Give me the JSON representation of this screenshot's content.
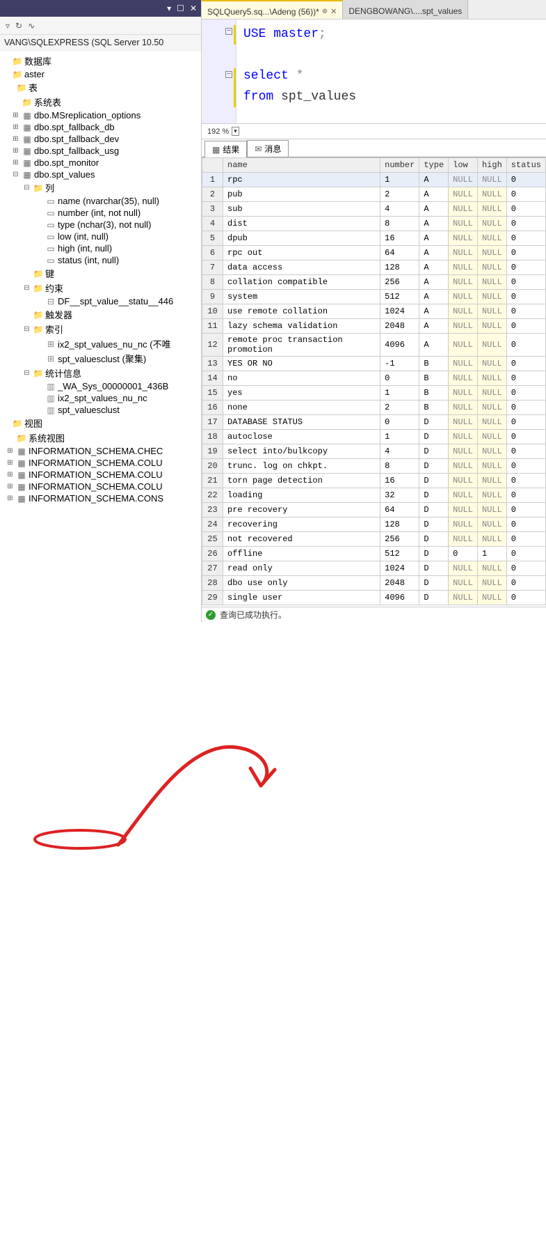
{
  "sidebar": {
    "server": "VANG\\SQLEXPRESS (SQL Server 10.50",
    "nodes": {
      "databases": "数据库",
      "master": "aster",
      "tables": "表",
      "systables": "系统表",
      "tableItems": [
        "dbo.MSreplication_options",
        "dbo.spt_fallback_db",
        "dbo.spt_fallback_dev",
        "dbo.spt_fallback_usg",
        "dbo.spt_monitor",
        "dbo.spt_values"
      ],
      "cols_label": "列",
      "cols": [
        "name (nvarchar(35), null)",
        "number (int, not null)",
        "type (nchar(3), not null)",
        "low (int, null)",
        "high (int, null)",
        "status (int, null)"
      ],
      "keys_label": "键",
      "constraints_label": "约束",
      "constraints": [
        "DF__spt_value__statu__446"
      ],
      "triggers_label": "触发器",
      "indexes_label": "索引",
      "indexes": [
        "ix2_spt_values_nu_nc (不唯",
        "spt_valuesclust (聚集)"
      ],
      "stats_label": "统计信息",
      "stats": [
        "_WA_Sys_00000001_436B",
        "ix2_spt_values_nu_nc",
        "spt_valuesclust"
      ],
      "views_label": "视图",
      "sysviews_label": "系统视图",
      "views": [
        "INFORMATION_SCHEMA.CHEC",
        "INFORMATION_SCHEMA.COLU",
        "INFORMATION_SCHEMA.COLU",
        "INFORMATION_SCHEMA.COLU",
        "INFORMATION_SCHEMA.CONS"
      ]
    }
  },
  "tabs": [
    {
      "label": "SQLQuery5.sq...\\Adeng (56))*",
      "active": true
    },
    {
      "label": "DENGBOWANG\\....spt_values",
      "active": false
    }
  ],
  "code": {
    "l1": "USE",
    "l1b": "master",
    "l2": "select",
    "l2b": "*",
    "l3": "from",
    "l3b": "spt_values"
  },
  "zoom": "192 %",
  "resultTabs": {
    "results": "结果",
    "messages": "消息"
  },
  "columns": [
    "",
    "name",
    "number",
    "type",
    "low",
    "high",
    "status"
  ],
  "rows": [
    {
      "n": 1,
      "name": "rpc",
      "number": "1",
      "type": "A",
      "low": "NULL",
      "high": "NULL",
      "status": "0"
    },
    {
      "n": 2,
      "name": "pub",
      "number": "2",
      "type": "A",
      "low": "NULL",
      "high": "NULL",
      "status": "0"
    },
    {
      "n": 3,
      "name": "sub",
      "number": "4",
      "type": "A",
      "low": "NULL",
      "high": "NULL",
      "status": "0"
    },
    {
      "n": 4,
      "name": "dist",
      "number": "8",
      "type": "A",
      "low": "NULL",
      "high": "NULL",
      "status": "0"
    },
    {
      "n": 5,
      "name": "dpub",
      "number": "16",
      "type": "A",
      "low": "NULL",
      "high": "NULL",
      "status": "0"
    },
    {
      "n": 6,
      "name": "rpc out",
      "number": "64",
      "type": "A",
      "low": "NULL",
      "high": "NULL",
      "status": "0"
    },
    {
      "n": 7,
      "name": "data access",
      "number": "128",
      "type": "A",
      "low": "NULL",
      "high": "NULL",
      "status": "0"
    },
    {
      "n": 8,
      "name": "collation compatible",
      "number": "256",
      "type": "A",
      "low": "NULL",
      "high": "NULL",
      "status": "0"
    },
    {
      "n": 9,
      "name": "system",
      "number": "512",
      "type": "A",
      "low": "NULL",
      "high": "NULL",
      "status": "0"
    },
    {
      "n": 10,
      "name": "use remote collation",
      "number": "1024",
      "type": "A",
      "low": "NULL",
      "high": "NULL",
      "status": "0"
    },
    {
      "n": 11,
      "name": "lazy schema validation",
      "number": "2048",
      "type": "A",
      "low": "NULL",
      "high": "NULL",
      "status": "0"
    },
    {
      "n": 12,
      "name": "remote proc transaction promotion",
      "number": "4096",
      "type": "A",
      "low": "NULL",
      "high": "NULL",
      "status": "0"
    },
    {
      "n": 13,
      "name": "YES OR NO",
      "number": "-1",
      "type": "B",
      "low": "NULL",
      "high": "NULL",
      "status": "0"
    },
    {
      "n": 14,
      "name": "no",
      "number": "0",
      "type": "B",
      "low": "NULL",
      "high": "NULL",
      "status": "0"
    },
    {
      "n": 15,
      "name": "yes",
      "number": "1",
      "type": "B",
      "low": "NULL",
      "high": "NULL",
      "status": "0"
    },
    {
      "n": 16,
      "name": "none",
      "number": "2",
      "type": "B",
      "low": "NULL",
      "high": "NULL",
      "status": "0"
    },
    {
      "n": 17,
      "name": "DATABASE STATUS",
      "number": "0",
      "type": "D",
      "low": "NULL",
      "high": "NULL",
      "status": "0"
    },
    {
      "n": 18,
      "name": "autoclose",
      "number": "1",
      "type": "D",
      "low": "NULL",
      "high": "NULL",
      "status": "0"
    },
    {
      "n": 19,
      "name": "select into/bulkcopy",
      "number": "4",
      "type": "D",
      "low": "NULL",
      "high": "NULL",
      "status": "0"
    },
    {
      "n": 20,
      "name": "trunc. log on chkpt.",
      "number": "8",
      "type": "D",
      "low": "NULL",
      "high": "NULL",
      "status": "0"
    },
    {
      "n": 21,
      "name": "torn page detection",
      "number": "16",
      "type": "D",
      "low": "NULL",
      "high": "NULL",
      "status": "0"
    },
    {
      "n": 22,
      "name": "loading",
      "number": "32",
      "type": "D",
      "low": "NULL",
      "high": "NULL",
      "status": "0"
    },
    {
      "n": 23,
      "name": "pre recovery",
      "number": "64",
      "type": "D",
      "low": "NULL",
      "high": "NULL",
      "status": "0"
    },
    {
      "n": 24,
      "name": "recovering",
      "number": "128",
      "type": "D",
      "low": "NULL",
      "high": "NULL",
      "status": "0"
    },
    {
      "n": 25,
      "name": "not recovered",
      "number": "256",
      "type": "D",
      "low": "NULL",
      "high": "NULL",
      "status": "0"
    },
    {
      "n": 26,
      "name": "offline",
      "number": "512",
      "type": "D",
      "low": "0",
      "high": "1",
      "status": "0"
    },
    {
      "n": 27,
      "name": "read only",
      "number": "1024",
      "type": "D",
      "low": "NULL",
      "high": "NULL",
      "status": "0"
    },
    {
      "n": 28,
      "name": "dbo use only",
      "number": "2048",
      "type": "D",
      "low": "NULL",
      "high": "NULL",
      "status": "0"
    },
    {
      "n": 29,
      "name": "single user",
      "number": "4096",
      "type": "D",
      "low": "NULL",
      "high": "NULL",
      "status": "0"
    }
  ],
  "status": "查询已成功执行。"
}
